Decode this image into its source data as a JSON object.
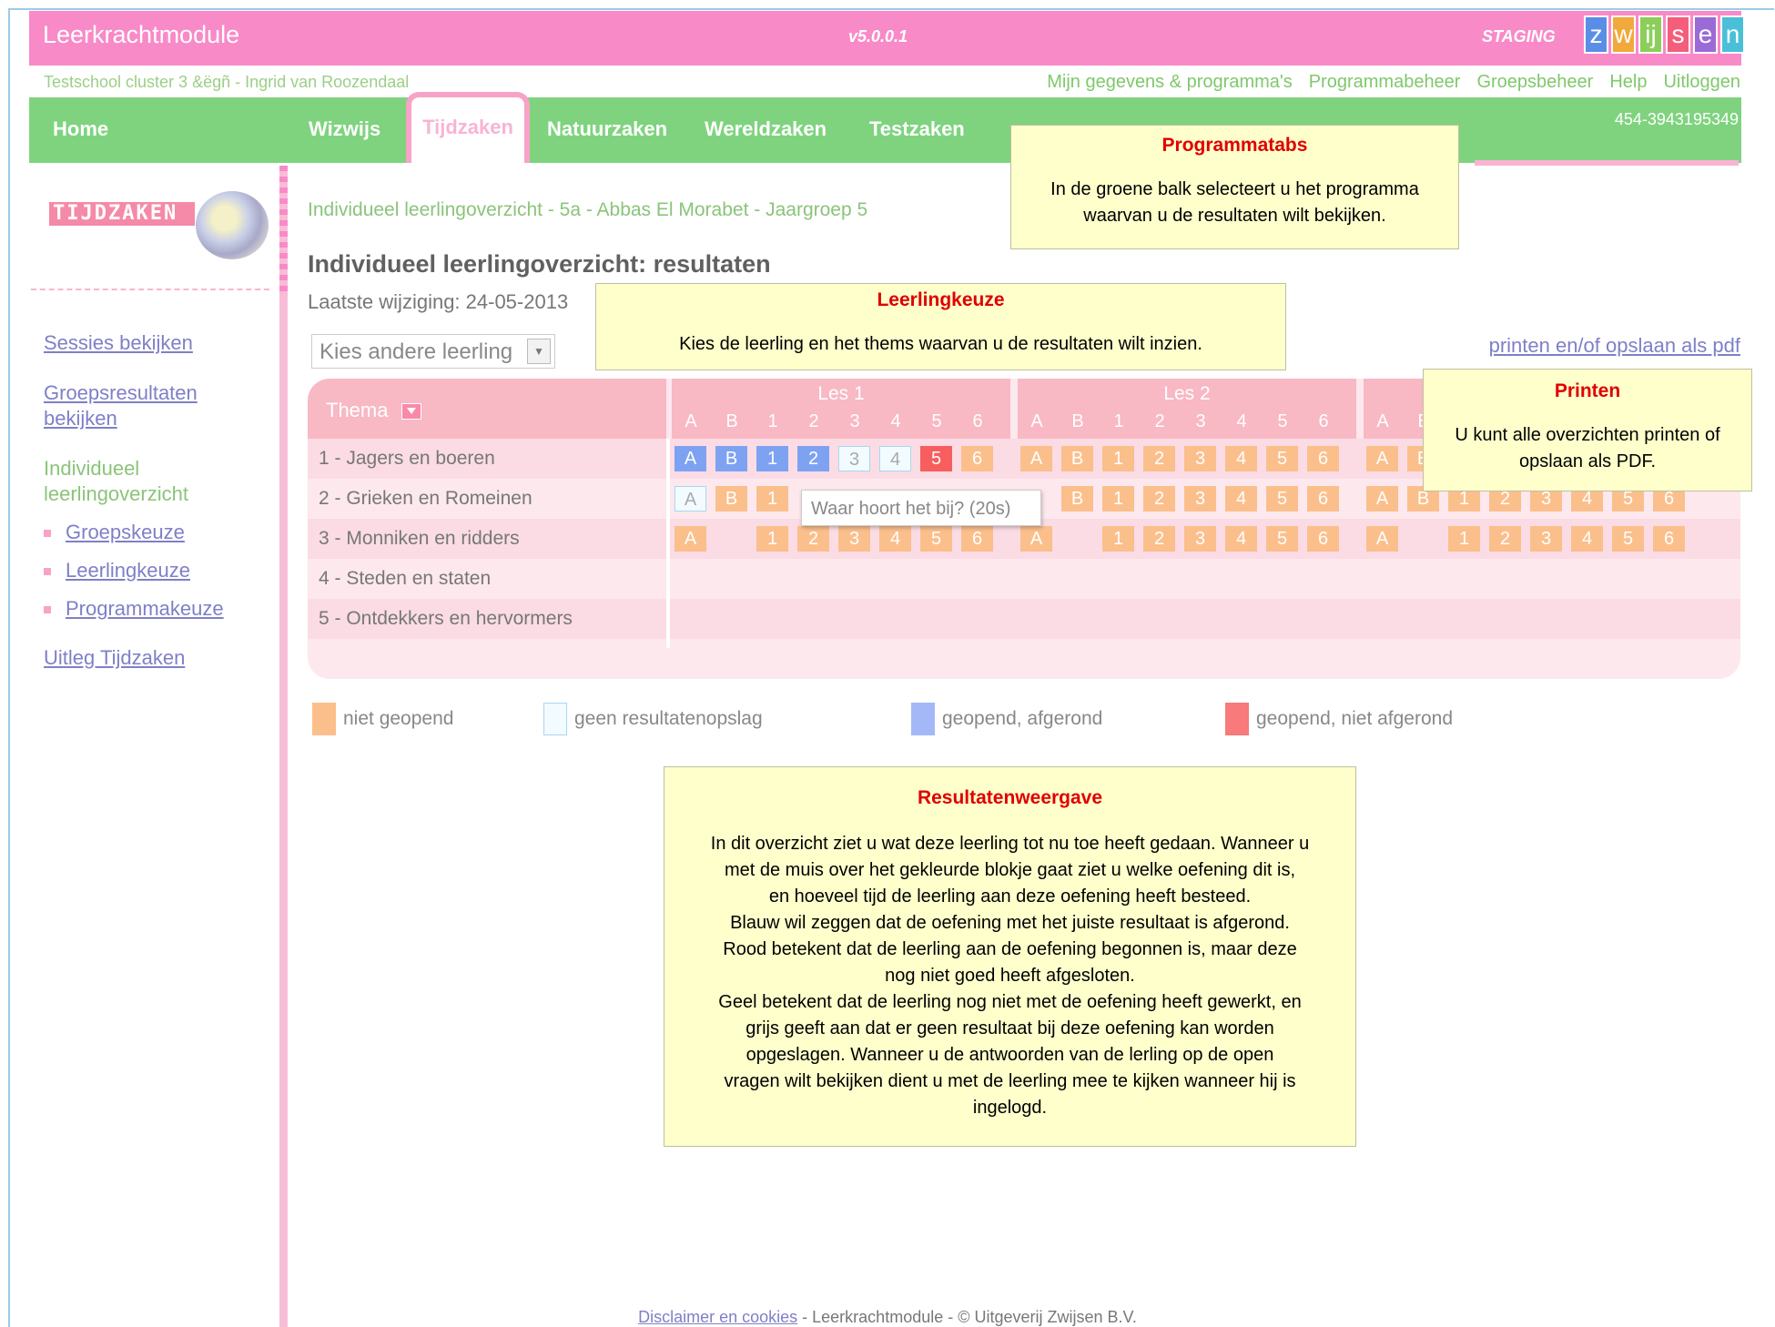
{
  "header": {
    "app_title": "Leerkrachtmodule",
    "version": "v5.0.0.1",
    "environment": "STAGING",
    "logo_letters": [
      "z",
      "w",
      "ij",
      "s",
      "e",
      "n"
    ],
    "logo_colors": [
      "#5a8ee6",
      "#f2a93b",
      "#8bcf5a",
      "#f55e7a",
      "#9a6ad6",
      "#4ac0d8"
    ]
  },
  "user_line": "Testschool cluster 3 &ëgñ - Ingrid van Roozendaal",
  "top_links": [
    "Mijn gegevens & programma's",
    "Programmabeheer",
    "Groepsbeheer",
    "Help",
    "Uitloggen"
  ],
  "nav": {
    "tabs": [
      "Home",
      "Wizwijs",
      "Tijdzaken",
      "Natuurzaken",
      "Wereldzaken",
      "Testzaken"
    ],
    "active_tab": "Tijdzaken",
    "code": "454-3943195349"
  },
  "sidebar": {
    "brand": "TIJDZAKEN",
    "links": [
      "Sessies bekijken",
      "Groepsresultaten bekijken"
    ],
    "current_section": "Individueel leerlingoverzicht",
    "sub_items": [
      "Groepskeuze",
      "Leerlingkeuze",
      "Programmakeuze"
    ],
    "footer_link": "Uitleg Tijdzaken"
  },
  "main": {
    "breadcrumb": "Individueel leerlingoverzicht - 5a - Abbas El Morabet - Jaargroep 5",
    "title": "Individueel leerlingoverzicht: resultaten",
    "last_modified": "Laatste wijziging: 24-05-2013",
    "student_select": "Kies andere leerling",
    "print_link": "printen en/of opslaan als pdf"
  },
  "table": {
    "theme_header": "Thema",
    "lessons": [
      "Les 1",
      "Les 2"
    ],
    "subcolumns": [
      "A",
      "B",
      "1",
      "2",
      "3",
      "4",
      "5",
      "6"
    ],
    "themes": [
      "1 - Jagers en boeren",
      "2 - Grieken en Romeinen",
      "3 - Monniken en ridders",
      "4 - Steden en staten",
      "5 - Ontdekkers en hervormers"
    ]
  },
  "tooltip": "Waar hoort het bij? (20s)",
  "legend": [
    {
      "label": "niet geopend",
      "color": "#fbbf8c"
    },
    {
      "label": "geen resultatenopslag",
      "color": "#f2fbff"
    },
    {
      "label": "geopend, afgerond",
      "color": "#a4b8f8"
    },
    {
      "label": "geopend, niet afgerond",
      "color": "#f87a7a"
    }
  ],
  "callouts": {
    "programmatabs": {
      "title": "Programmatabs",
      "body": "In de groene balk selecteert u het programma waarvan u de resultaten wilt bekijken."
    },
    "leerlingkeuze": {
      "title": "Leerlingkeuze",
      "body": "Kies de leerling en het thems  waarvan u de resultaten wilt inzien."
    },
    "printen": {
      "title": "Printen",
      "body": "U kunt alle overzichten printen of opslaan als PDF."
    },
    "resultatenweergave": {
      "title": "Resultatenweergave",
      "body_lines": [
        "In dit overzicht ziet u wat deze leerling tot nu toe heeft gedaan. Wanneer u",
        "met de muis over het gekleurde blokje gaat ziet u welke oefening dit is,",
        "en hoeveel tijd de leerling aan deze oefening heeft besteed.",
        "Blauw wil zeggen dat de oefening met het juiste resultaat is afgerond.",
        "Rood betekent dat de leerling aan de oefening begonnen is, maar deze",
        "nog niet goed heeft afgesloten.",
        "Geel betekent dat de leerling nog niet met de oefening heeft gewerkt, en",
        "grijs geeft aan dat er geen resultaat bij deze oefening kan worden",
        "opgeslagen. Wanneer u de antwoorden van de lerling op de open",
        "vragen wilt bekijken dient u met de leerling mee te kijken wanneer hij is",
        "ingelogd."
      ]
    }
  },
  "footer": {
    "link": "Disclaimer en cookies",
    "text": " - Leerkrachtmodule - © Uitgeverij Zwijsen B.V."
  }
}
